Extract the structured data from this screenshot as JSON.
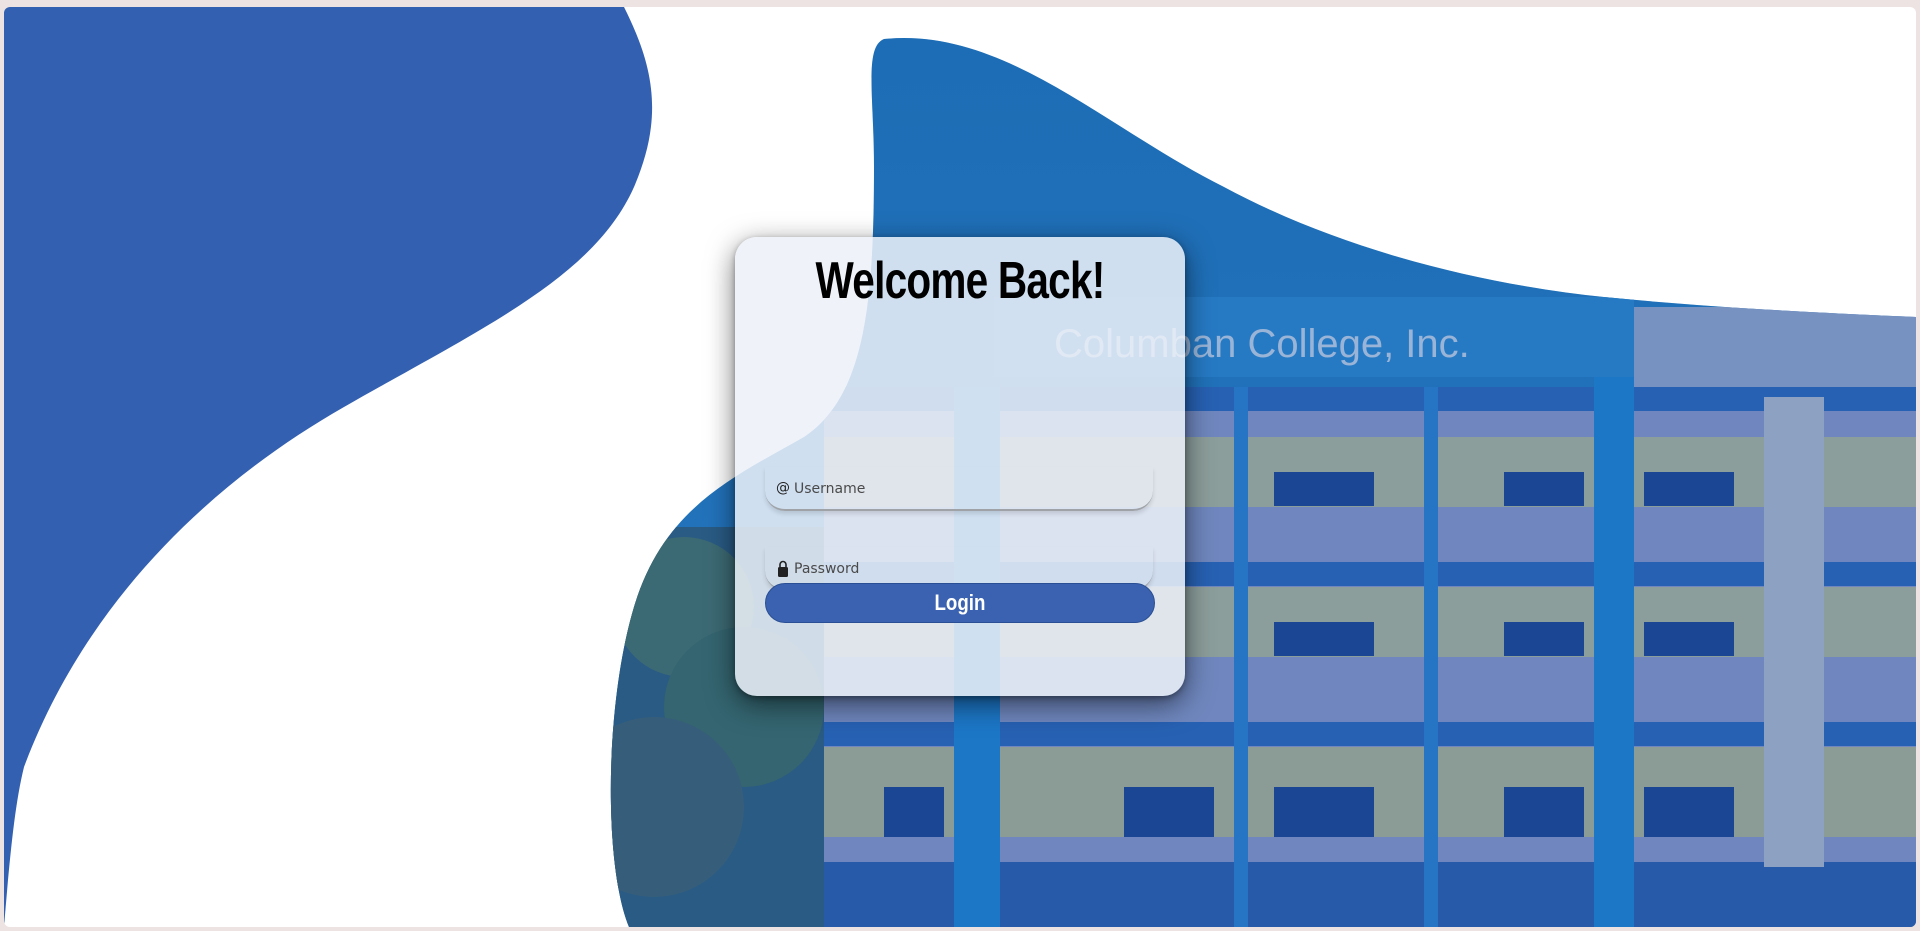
{
  "login": {
    "title": "Welcome Back!",
    "username_placeholder": "Username",
    "password_placeholder": "Password",
    "username_icon": "@",
    "login_label": "Login"
  },
  "background": {
    "building_sign": "Columban College, Inc."
  },
  "colors": {
    "primary_blue": "#3360b0",
    "photo_blue": "#1e79c0",
    "button_blue": "#3a62b0"
  }
}
